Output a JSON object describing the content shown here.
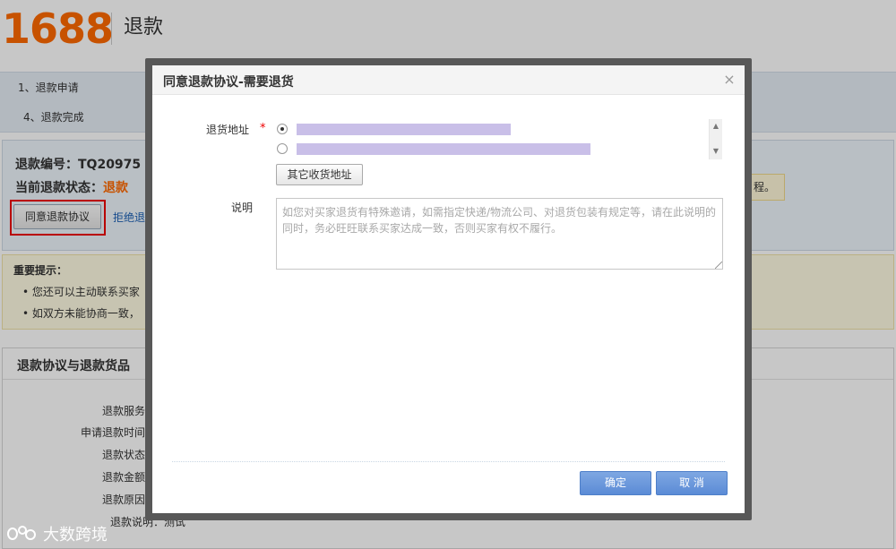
{
  "header": {
    "logo": "1688",
    "title": "退款"
  },
  "steps": {
    "step1": "1、退款申请",
    "step4": "4、退款完成"
  },
  "info": {
    "refund_no": "退款编号：TQ20975",
    "status_label": "当前退款状态：",
    "status_value": "退款",
    "agree_button": "同意退款协议",
    "reject_link": "拒绝退",
    "right_tip": "程。"
  },
  "notice": {
    "title": "重要提示：",
    "items": [
      "• 您还可以主动联系买家",
      "• 如双方未能协商一致，"
    ]
  },
  "detail": {
    "title": "退款协议与退款货品",
    "rows": [
      "退款服务",
      "申请退款时间",
      "退款状态",
      "退款金额",
      "退款原因",
      "退款说明：测试"
    ]
  },
  "modal": {
    "title": "同意退款协议-需要退货",
    "close_glyph": "×",
    "address_label": "退货地址",
    "required_mark": "*",
    "other_address_button": "其它收货地址",
    "note_label": "说明",
    "note_placeholder": "如您对买家退货有特殊邀请，如需指定快递/物流公司、对退货包装有规定等，请在此说明的同时，务必旺旺联系买家达成一致，否则买家有权不履行。",
    "ok_button": "确定",
    "cancel_button": "取 消",
    "scroll_up_glyph": "▲",
    "scroll_down_glyph": "▼"
  },
  "watermark": {
    "text": "大数跨境"
  },
  "colors": {
    "brand": "#ff6a00",
    "primary_button": "#5b8bd6",
    "highlight_box": "#ee0000",
    "redacted_address": "#c9bfe8"
  }
}
